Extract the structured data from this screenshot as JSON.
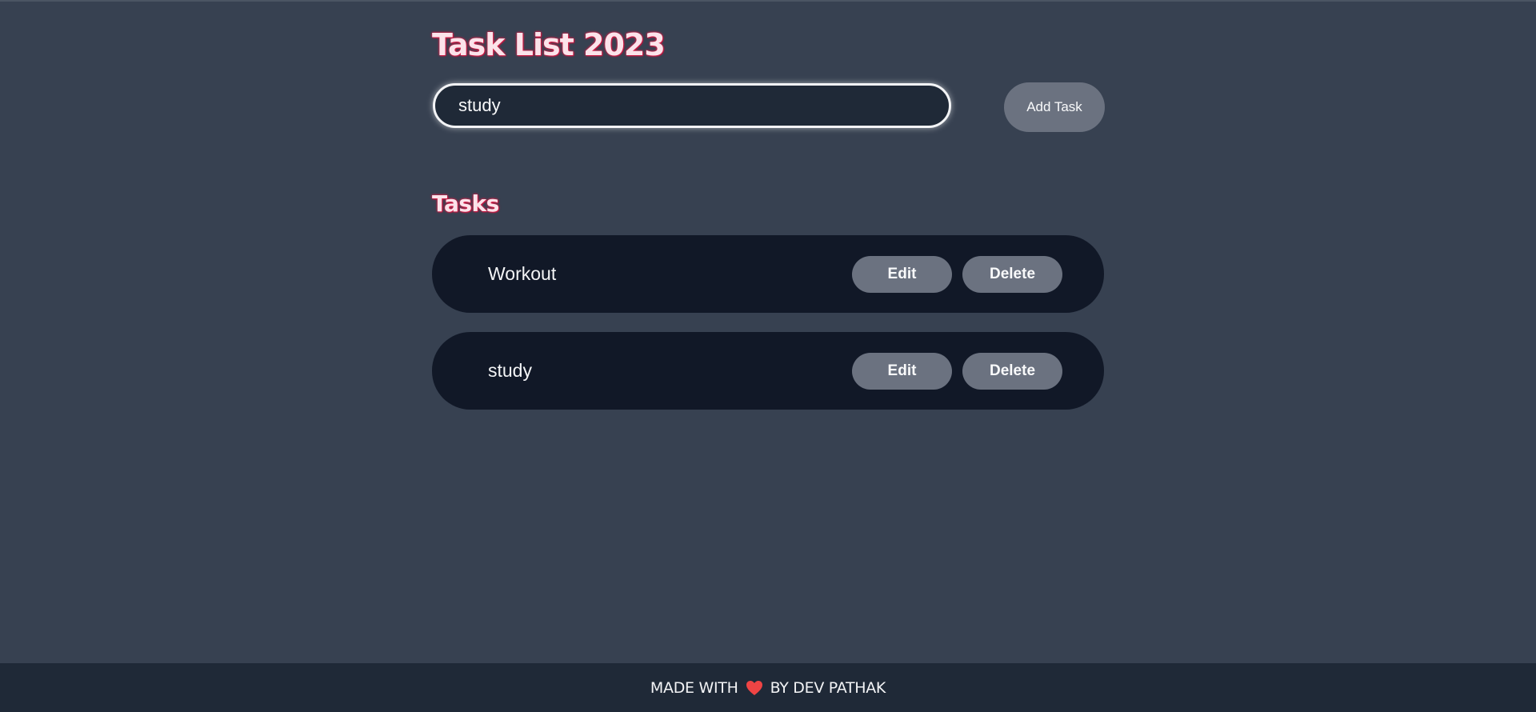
{
  "header": {
    "title": "Task List 2023"
  },
  "form": {
    "input_value": "study",
    "add_button_label": "Add Task"
  },
  "tasks_section": {
    "title": "Tasks",
    "edit_label": "Edit",
    "delete_label": "Delete",
    "items": [
      {
        "name": "Workout"
      },
      {
        "name": "study"
      }
    ]
  },
  "footer": {
    "prefix": "MADE WITH",
    "suffix": "BY DEV PATHAK",
    "heart_icon": "heart-icon",
    "heart_color": "#ef4444"
  },
  "colors": {
    "background": "#374151",
    "card": "#111827",
    "button": "#6b7280",
    "footer": "#1f2937",
    "title_glow": "#e11d48"
  }
}
